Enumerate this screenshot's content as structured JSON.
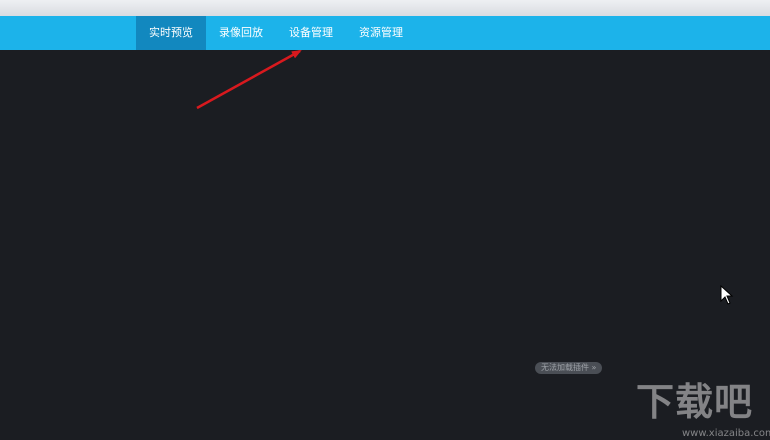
{
  "nav": {
    "tabs": [
      {
        "label": "实时预览",
        "active": true
      },
      {
        "label": "录像回放",
        "active": false
      },
      {
        "label": "设备管理",
        "active": false
      },
      {
        "label": "资源管理",
        "active": false
      }
    ]
  },
  "player": {
    "plugin_notice": "无法加载插件 »"
  },
  "watermark": {
    "logo_text": "下载吧",
    "url": "www.xiazaiba.com"
  },
  "colors": {
    "nav_background": "#1cb3ea",
    "nav_active": "#1288bf",
    "content_background": "#1b1d22",
    "annotation_arrow": "#d8191e"
  }
}
